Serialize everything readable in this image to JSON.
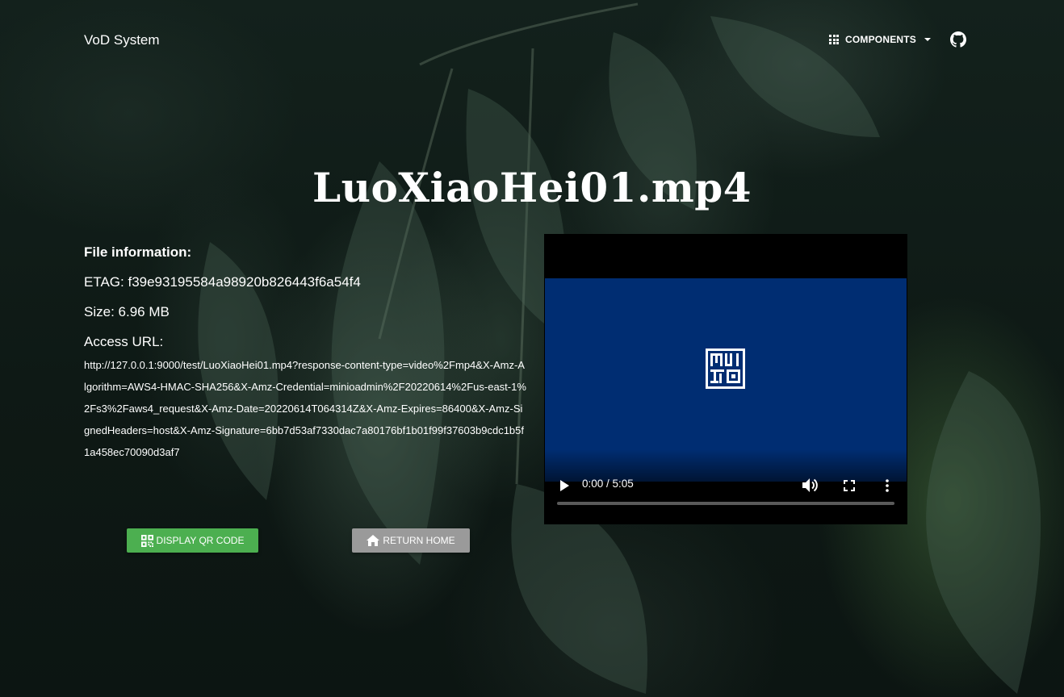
{
  "nav": {
    "brand": "VoD System",
    "components_label": "COMPONENTS"
  },
  "title": "LuoXiaoHei01.mp4",
  "file_info": {
    "heading": "File information:",
    "etag": "ETAG: f39e93195584a98920b826443f6a54f4",
    "size": "Size: 6.96 MB",
    "access_url_label": "Access URL:",
    "access_url": "http://127.0.0.1:9000/test/LuoXiaoHei01.mp4?response-content-type=video%2Fmp4&X-Amz-Algorithm=AWS4-HMAC-SHA256&X-Amz-Credential=minioadmin%2F20220614%2Fus-east-1%2Fs3%2Faws4_request&X-Amz-Date=20220614T064314Z&X-Amz-Expires=86400&X-Amz-SignedHeaders=host&X-Amz-Signature=6bb7d53af7330dac7a80176bf1b01f99f37603b9cdc1b5f1a458ec70090d3af7"
  },
  "buttons": {
    "qr_label": "DISPLAY QR CODE",
    "home_label": "RETURN HOME"
  },
  "player": {
    "time": "0:00 / 5:05",
    "progress": 0,
    "frame_color": "#002d72"
  },
  "colors": {
    "qr_button": "#4caf50",
    "home_button": "#9a9a9a"
  }
}
